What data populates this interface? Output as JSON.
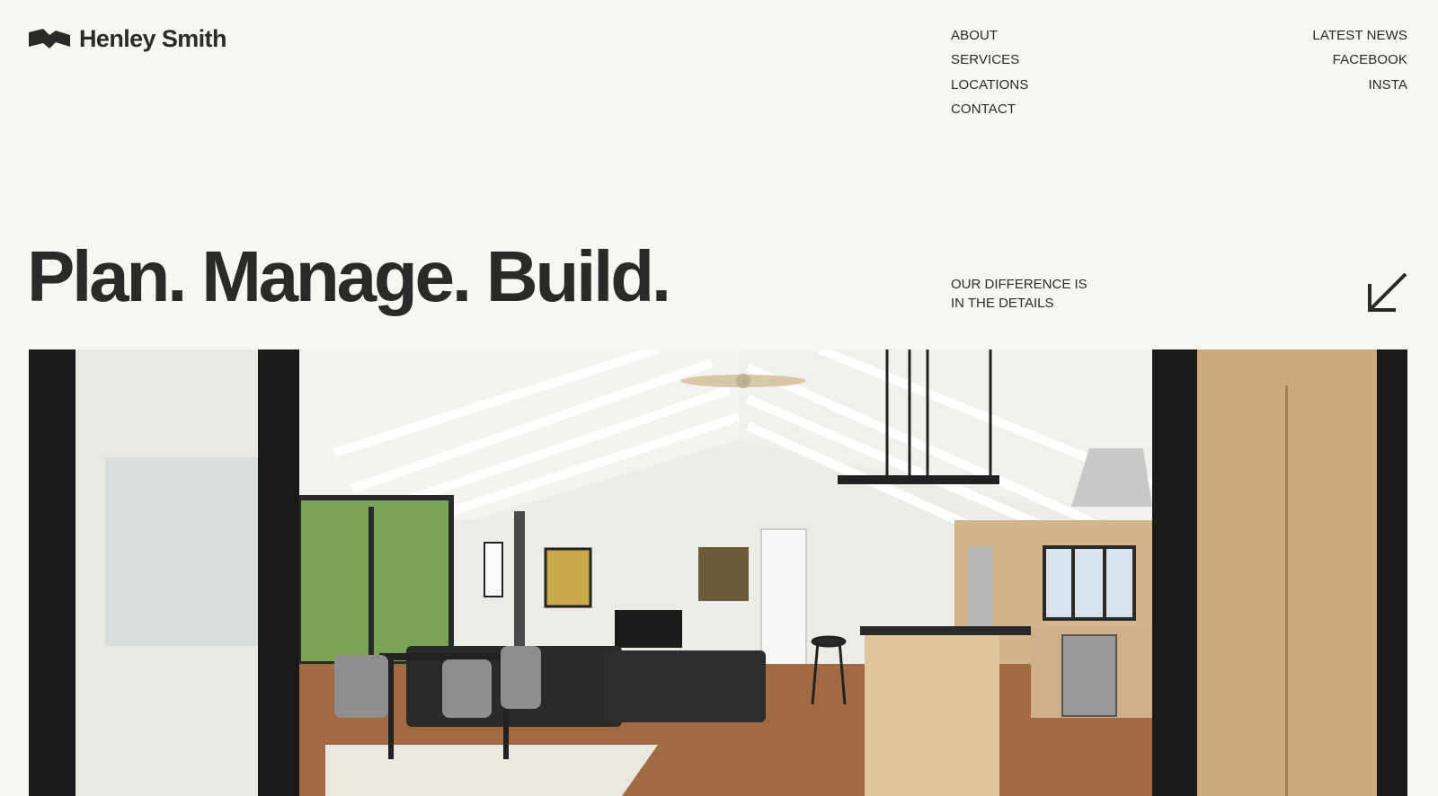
{
  "brand": {
    "name": "Henley Smith",
    "logo_icon": "henley-smith-mark"
  },
  "nav_main": [
    {
      "label": "ABOUT"
    },
    {
      "label": "SERVICES"
    },
    {
      "label": "LOCATIONS"
    },
    {
      "label": "CONTACT"
    }
  ],
  "nav_social": [
    {
      "label": "LATEST NEWS"
    },
    {
      "label": "FACEBOOK"
    },
    {
      "label": "INSTA"
    }
  ],
  "hero": {
    "headline": "Plan. Manage. Build.",
    "tagline_line1": "OUR DIFFERENCE IS",
    "tagline_line2": "IN THE DETAILS",
    "arrow_icon": "arrow-down-left-icon"
  },
  "colors": {
    "background": "#f7f6f2",
    "text": "#2b2a28"
  }
}
